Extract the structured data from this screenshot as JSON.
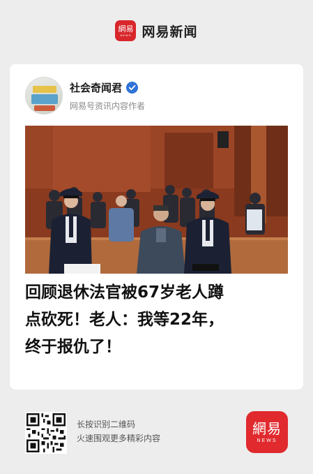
{
  "app": {
    "brand_name": "网易新闻",
    "logo_text": "網易",
    "logo_sub": "NEWS"
  },
  "author": {
    "name": "社会奇闻君",
    "description": "网易号资讯内容作者",
    "verified": true
  },
  "article": {
    "headline_lines": [
      "回顾退休法官被67岁老人蹲",
      "点砍死！老人：我等22年，",
      "终于报仇了！"
    ]
  },
  "footer": {
    "qr_lines": [
      "长按识别二维码",
      "火速围观更多精彩内容"
    ]
  },
  "colors": {
    "brand_red": "#d8262b",
    "verified_blue": "#2f73d8",
    "background": "#ededed"
  }
}
